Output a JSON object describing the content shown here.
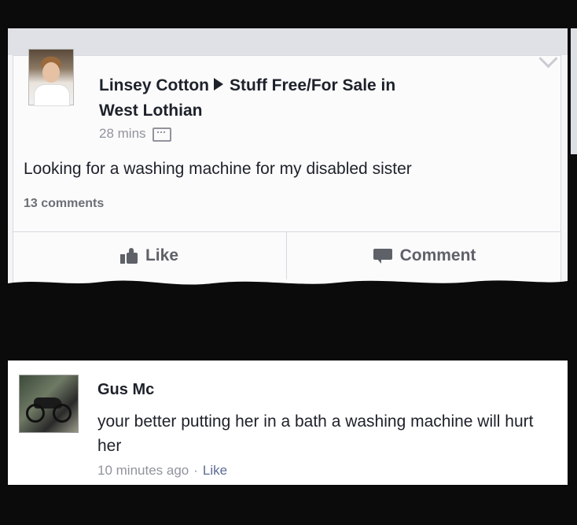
{
  "post": {
    "author": "Linsey Cotton",
    "group": "Stuff Free/For Sale in",
    "group_line2": "West Lothian",
    "time": "28 mins",
    "text": "Looking for a washing machine for my disabled sister",
    "comments_count": "13 comments",
    "actions": {
      "like": "Like",
      "comment": "Comment"
    }
  },
  "comment": {
    "author": "Gus Mc",
    "text": "your better putting her in a bath a washing machine will hurt her",
    "time": "10 minutes ago",
    "separator": "·",
    "like": "Like"
  },
  "icons": {
    "post_menu": "chevron-down-icon",
    "audience": "group-members-icon",
    "like": "thumbs-up-icon",
    "comment": "comment-icon",
    "share_arrow": "triangle-right-icon"
  },
  "colors": {
    "text": "#1d2129",
    "meta": "#90949c",
    "action": "#5e6168",
    "background": "#0b0b0b",
    "card": "#fbfbfc"
  }
}
